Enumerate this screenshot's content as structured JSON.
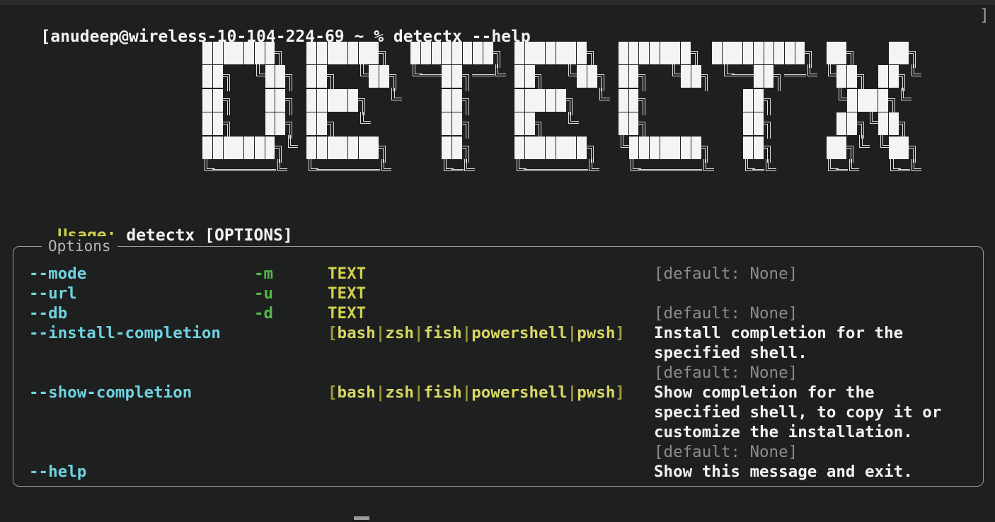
{
  "window": {
    "background_color": "#1e1f1f",
    "foreground_color": "#e6e6e6",
    "title_strip_color": "#2c2c2c"
  },
  "prompt": {
    "text": "[anudeep@wireless-10-104-224-69 ~ % detectx --help",
    "trailing_glyph": "]"
  },
  "logo": {
    "text": "DETECTX",
    "style": "ascii-block-shadow",
    "block_color": "#f4f4f4",
    "shadow_color": "#dcdcdc",
    "rows": [
      "BBBBBBBt..BBBBBBBt..BBBBBBBBt.BBBBBBBt..BBBBBBBt.BBBBBBBBBt.BBt...BBt",
      "BBt..vBBt.BBt..vBBt.vhhBBthhv.BBt..vBBt.BBt..vBBt.vhhBBthhv.vBBt.BBtv",
      "BBt...BBt.BBBBBt..v....BBt....BBBBBt..v.BBt.........BBt......vBBBBtv.",
      "BBt...BBt.BBt..v.......BBt....BBt..v....BBt.........BBt......BBtvBBt.",
      "BBBBBBBtv.BBBBBBBt.....BBt....BBBBBBBt..vBBBBBBBt...BBt.....BBtv.vBBt",
      "vhhhhhhv..vhhhhhhv.....vhv....vhhhhhhv...vhhhhhhv...vhv.....vhv...vhv"
    ]
  },
  "usage": {
    "label": "Usage:",
    "command": "detectx [OPTIONS]",
    "label_color": "#d2d14c",
    "command_color": "#f2f2f2"
  },
  "options_panel": {
    "title": "Options",
    "border_color": "#9a9a9a",
    "rows": [
      {
        "long": "--mode",
        "short": "-m",
        "metavar": "TEXT",
        "help": "",
        "default": "[default: None]"
      },
      {
        "long": "--url",
        "short": "-u",
        "metavar": "TEXT",
        "help": "",
        "default": ""
      },
      {
        "long": "--db",
        "short": "-d",
        "metavar": "TEXT",
        "help": "",
        "default": "[default: None]"
      },
      {
        "long": "--install-completion",
        "short": "",
        "metavar": "",
        "choices": [
          "bash",
          "zsh",
          "fish",
          "powershell",
          "pwsh"
        ],
        "help_lines": [
          "Install completion for the",
          "specified shell."
        ],
        "default": "[default: None]"
      },
      {
        "long": "--show-completion",
        "short": "",
        "metavar": "",
        "choices": [
          "bash",
          "zsh",
          "fish",
          "powershell",
          "pwsh"
        ],
        "help_lines": [
          "Show completion for the",
          "specified shell, to copy it or",
          "customize the installation."
        ],
        "default": "[default: None]"
      },
      {
        "long": "--help",
        "short": "",
        "metavar": "",
        "help_lines": [
          "Show this message and exit."
        ],
        "default": ""
      }
    ],
    "colors": {
      "long_option": "#6fd2de",
      "short_option": "#54b74a",
      "metavar": "#d2d14c",
      "choice_bracket": "#9d9c39",
      "choice_value": "#d8d766",
      "help_text": "#f2f2f2",
      "default_text": "#8c8c8c"
    }
  },
  "cursor": {
    "shape": "underline-block",
    "color": "#9a9a9a"
  }
}
